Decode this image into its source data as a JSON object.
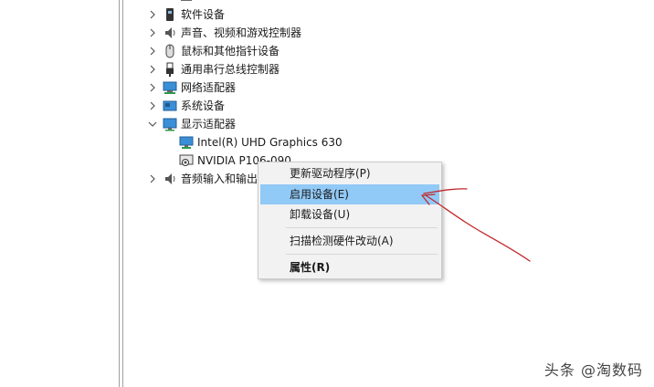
{
  "tree": {
    "items": [
      {
        "label": "软件设备",
        "icon": "software-device-icon"
      },
      {
        "label": "声音、视频和游戏控制器",
        "icon": "speaker-icon"
      },
      {
        "label": "鼠标和其他指针设备",
        "icon": "mouse-icon"
      },
      {
        "label": "通用串行总线控制器",
        "icon": "usb-icon"
      },
      {
        "label": "网络适配器",
        "icon": "network-adapter-icon"
      },
      {
        "label": "系统设备",
        "icon": "system-device-icon"
      },
      {
        "label": "显示适配器",
        "icon": "display-adapter-icon",
        "expanded": true
      },
      {
        "label": "Intel(R) UHD Graphics 630",
        "icon": "monitor-icon",
        "child": true
      },
      {
        "label": "NVIDIA P106-090",
        "icon": "disabled-monitor-icon",
        "child": true,
        "selected": true
      },
      {
        "label": "音频输入和输出",
        "icon": "speaker-icon"
      }
    ]
  },
  "context_menu": {
    "items": [
      {
        "label": "更新驱动程序(P)"
      },
      {
        "label": "启用设备(E)",
        "highlighted": true
      },
      {
        "label": "卸载设备(U)"
      },
      {
        "label": "扫描检测硬件改动(A)"
      },
      {
        "label": "属性(R)",
        "bold": true
      }
    ]
  },
  "watermark": "头条 @淘数码",
  "colors": {
    "highlight": "#91c9f7",
    "annotation": "#c0282a",
    "menu_bg": "#f2f2f2"
  }
}
